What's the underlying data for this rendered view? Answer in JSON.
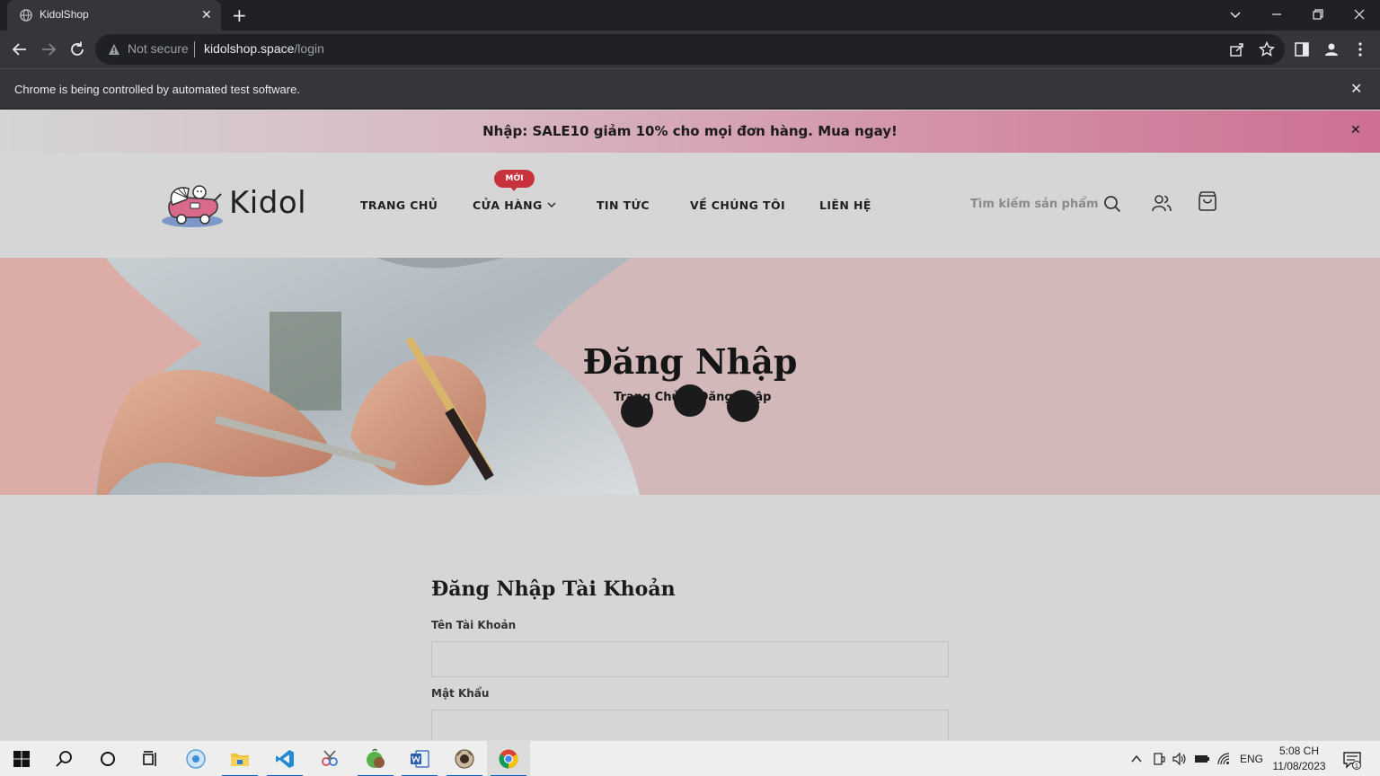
{
  "browser": {
    "tab_title": "KidolShop",
    "new_tab_label": "+",
    "not_secure_label": "Not secure",
    "url_host": "kidolshop.space",
    "url_path": "/login",
    "infobar_text": "Chrome is being controlled by automated test software.",
    "close_glyph": "✕"
  },
  "promo": {
    "text": "Nhập: SALE10 giảm 10% cho mọi đơn hàng. Mua ngay!",
    "close_glyph": "✕"
  },
  "header": {
    "logo_text": "Kidol",
    "nav": [
      "TRANG CHỦ",
      "CỬA HÀNG",
      "TIN TỨC",
      "VỀ CHÚNG TÔI",
      "LIÊN HỆ"
    ],
    "new_badge": "MỚI",
    "search_placeholder": "Tìm kiếm sản phẩm"
  },
  "hero": {
    "title": "Đăng Nhập",
    "breadcrumb_home": "Trang Chủ",
    "breadcrumb_sep": "\\",
    "breadcrumb_current": "Đăng Nhập"
  },
  "login": {
    "title": "Đăng Nhập Tài Khoản",
    "username_label": "Tên Tài Khoản",
    "username_value": "",
    "password_label": "Mật Khẩu",
    "password_value": ""
  },
  "taskbar": {
    "lang": "ENG",
    "time": "5:08 CH",
    "date": "11/08/2023",
    "notification_count": "1"
  },
  "colors": {
    "promo_pink": "#cd6f93",
    "badge_red": "#c8323d",
    "hero_pink": "#d2b8b9"
  }
}
